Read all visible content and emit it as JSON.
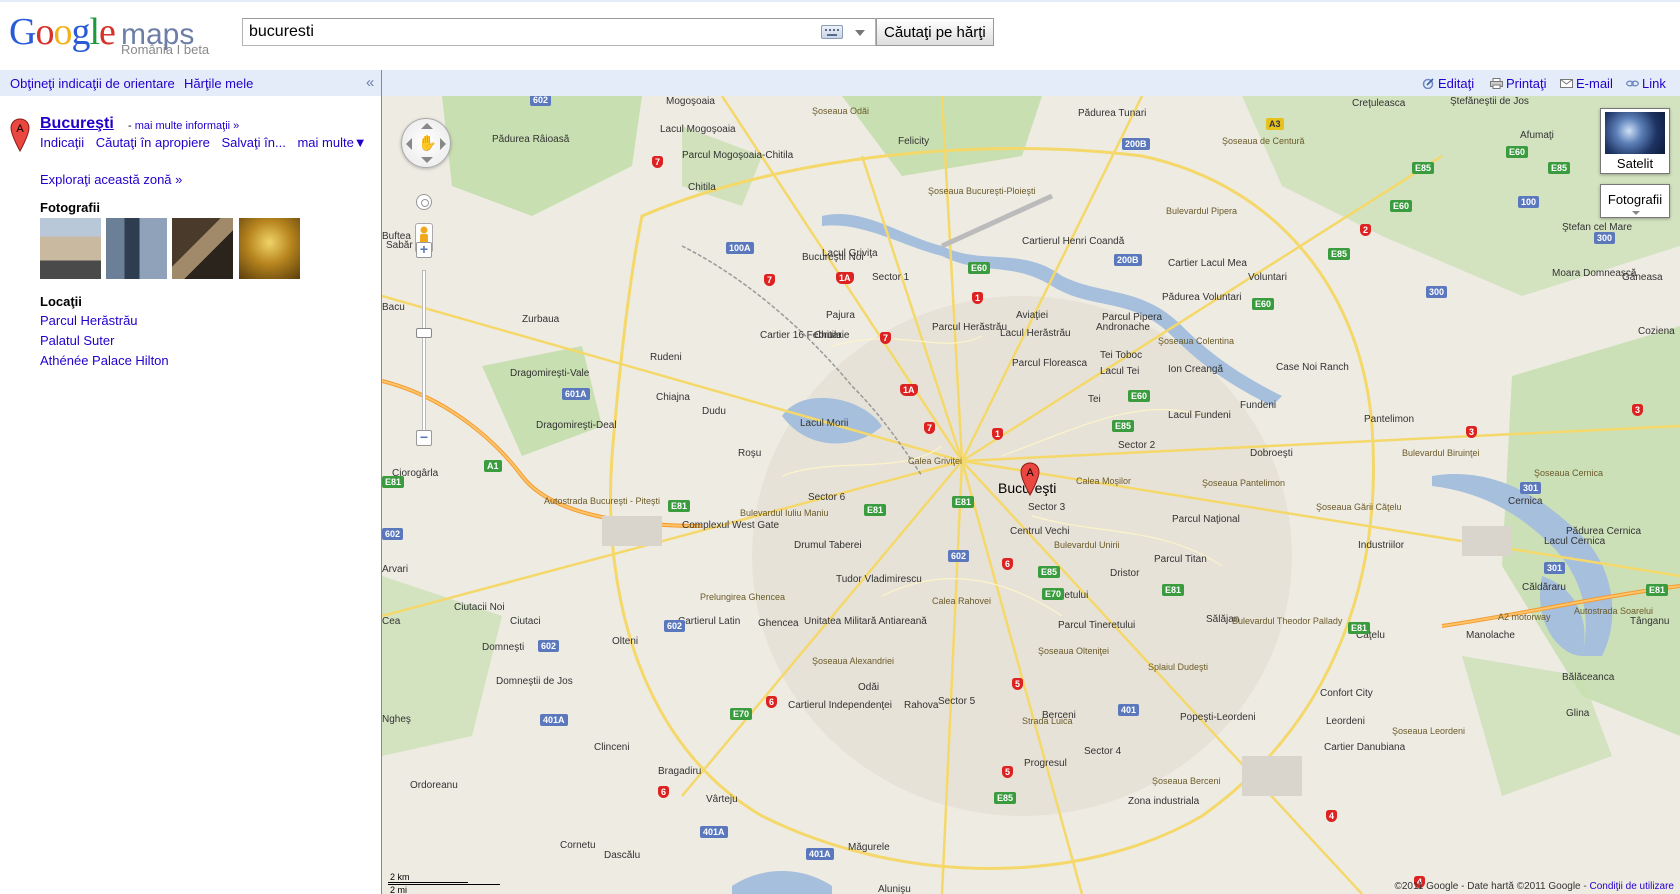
{
  "header": {
    "logo_google": "Google",
    "logo_maps": "maps",
    "logo_sub": "România I beta",
    "search_value": "bucuresti",
    "search_button": "Căutaţi pe hărţi"
  },
  "toolbar": {
    "directions": "Obţineţi indicaţii de orientare",
    "my_maps": "Hărţile mele",
    "collapse": "«",
    "edit": "Editaţi",
    "print": "Printaţi",
    "email": "E-mail",
    "link": "Link"
  },
  "result": {
    "marker": "A",
    "title": "Bucureşti",
    "dash": "-",
    "more_info": "mai multe informaţii »",
    "actions": {
      "directions": "Indicaţii",
      "nearby": "Căutaţi în apropiere",
      "save": "Salvaţi în...",
      "more": "mai multe▼"
    },
    "explore": "Exploraţi această zonă »",
    "photos_heading": "Fotografii",
    "locations_heading": "Locaţii",
    "locations": [
      "Parcul Herăstrău",
      "Palatul Suter",
      "Athénée Palace Hilton"
    ]
  },
  "map": {
    "city_label": "Bucureşti",
    "marker": "A",
    "satellite_label": "Satelit",
    "photos_label": "Fotografii",
    "scale_label": "2 mi",
    "scale_km": "2 km",
    "copyright": "©2011 Google - Date hartă ©2011 Google -",
    "terms": "Condiţii de utilizare",
    "labels": [
      "Mogoşoaia",
      "Lacul Mogoşoaia",
      "Parcul Mogoşoaia-Chitila",
      "Chitila",
      "Buftea",
      "Pădurea Tunari",
      "Felicity",
      "Creţuleasca",
      "Ştefăneştii de Jos",
      "Afumaţi",
      "Pădurea Râioasă",
      "Lacul Griviţa",
      "Bucureştii Noi",
      "Sector 1",
      "Cartierul Henri Coandă",
      "Ştefan cel Mare",
      "Voluntari",
      "Găneasa",
      "Moara Domnească",
      "Cartier Lacul Mea",
      "Pădurea Voluntari",
      "Andronache",
      "Aviaţiei",
      "Parcul Herăstrău",
      "Lacul Herăstrău",
      "Parcul Pipera",
      "Tei Toboc",
      "Ion Creangă",
      "Case Noi Ranch",
      "Zurbaua",
      "Pajura",
      "Cartier 16 Februarie",
      "Chitila",
      "Rudeni",
      "Dragomireşti-Vale",
      "Chiajna",
      "Dudu",
      "Lacul Morii",
      "Parcul Floreasca",
      "Lacul Tei",
      "Tei",
      "Fundeni",
      "Pantelimon",
      "Coziena",
      "Dragomireşti-Deal",
      "Roşu",
      "Sector 2",
      "Lacul Fundeni",
      "Dobroeşti",
      "Ciorogârla",
      "Sector 6",
      "Bucureşti",
      "Sector 3",
      "Parcul Naţional",
      "Cernica",
      "Pădurea Cernica",
      "Complexul West Gate",
      "Drumul Taberei",
      "Centrul Vechi",
      "Bulevardul Unirii",
      "Industriilor",
      "Lacul Cernica",
      "Ciutacii Noi",
      "Ciutaci",
      "Tudor Vladimirescu",
      "Tineretului",
      "Dristor",
      "Parcul Titan",
      "Căldăraru",
      "Tânganu",
      "Domneşti",
      "Olteni",
      "Cartierul Latin",
      "Ghencea",
      "Unitatea Militară Antiareană",
      "Parcul Tineretului",
      "Sălăjan",
      "Căţelu",
      "Manolache",
      "Bălăceanca",
      "Domneştii de Jos",
      "Odăi",
      "Rahova",
      "Sector 5",
      "Berceni",
      "Popeşti-Leordeni",
      "Confort City",
      "Glina",
      "Leordeni",
      "Cartierul Independenţei",
      "Clinceni",
      "Bragadiru",
      "Ordoreanu",
      "Progresul",
      "Sector 4",
      "Cartier Danubiana",
      "Vârteju",
      "Zona industriala",
      "Cornetu",
      "Dascălu",
      "Măgurele",
      "Alunişu",
      "Bacu",
      "Sabăr",
      "Arvari",
      "Ngheş",
      "Cea",
      "Şoseaua Odăi",
      "Şoseaua Bucureşti-Ploieşti",
      "Bulevardul Pipera",
      "Şoseaua de Centură",
      "Şoseaua Colentina",
      "Bulevardul Biruinţei",
      "Şoseaua Cernica",
      "Autostrada Bucureşti - Piteşti",
      "Bulevardul Iuliu Maniu",
      "Calea Griviţei",
      "Calea Moşilor",
      "Şoseaua Pantelimon",
      "Şoseaua Gării Căţelu",
      "Bulevardul Theodor Pallady",
      "Prelungirea Ghencea",
      "Şoseaua Alexandriei",
      "Calea Rahovei",
      "Şoseaua Olteniţei",
      "Splaiul Dudeşti",
      "Şoseaua Leordeni",
      "Şoseaua Berceni",
      "Strada Luica",
      "A2 motorway",
      "Autostrada Soarelui"
    ],
    "shields": [
      "602",
      "7",
      "A3",
      "E85",
      "E60",
      "E85",
      "E60",
      "200B",
      "100A",
      "7",
      "1A",
      "1",
      "E60",
      "200B",
      "E85",
      "2",
      "100",
      "300",
      "300",
      "E60",
      "7",
      "1A",
      "7",
      "1",
      "E60",
      "E85",
      "601A",
      "A1",
      "E81",
      "E81",
      "E81",
      "E81",
      "602",
      "6",
      "E85",
      "E70",
      "301",
      "301",
      "E81",
      "602",
      "602",
      "E70",
      "6",
      "401",
      "5",
      "401A",
      "6",
      "401A",
      "E85",
      "5",
      "401A",
      "4",
      "3",
      "3",
      "E81",
      "E81",
      "602",
      "4"
    ]
  }
}
